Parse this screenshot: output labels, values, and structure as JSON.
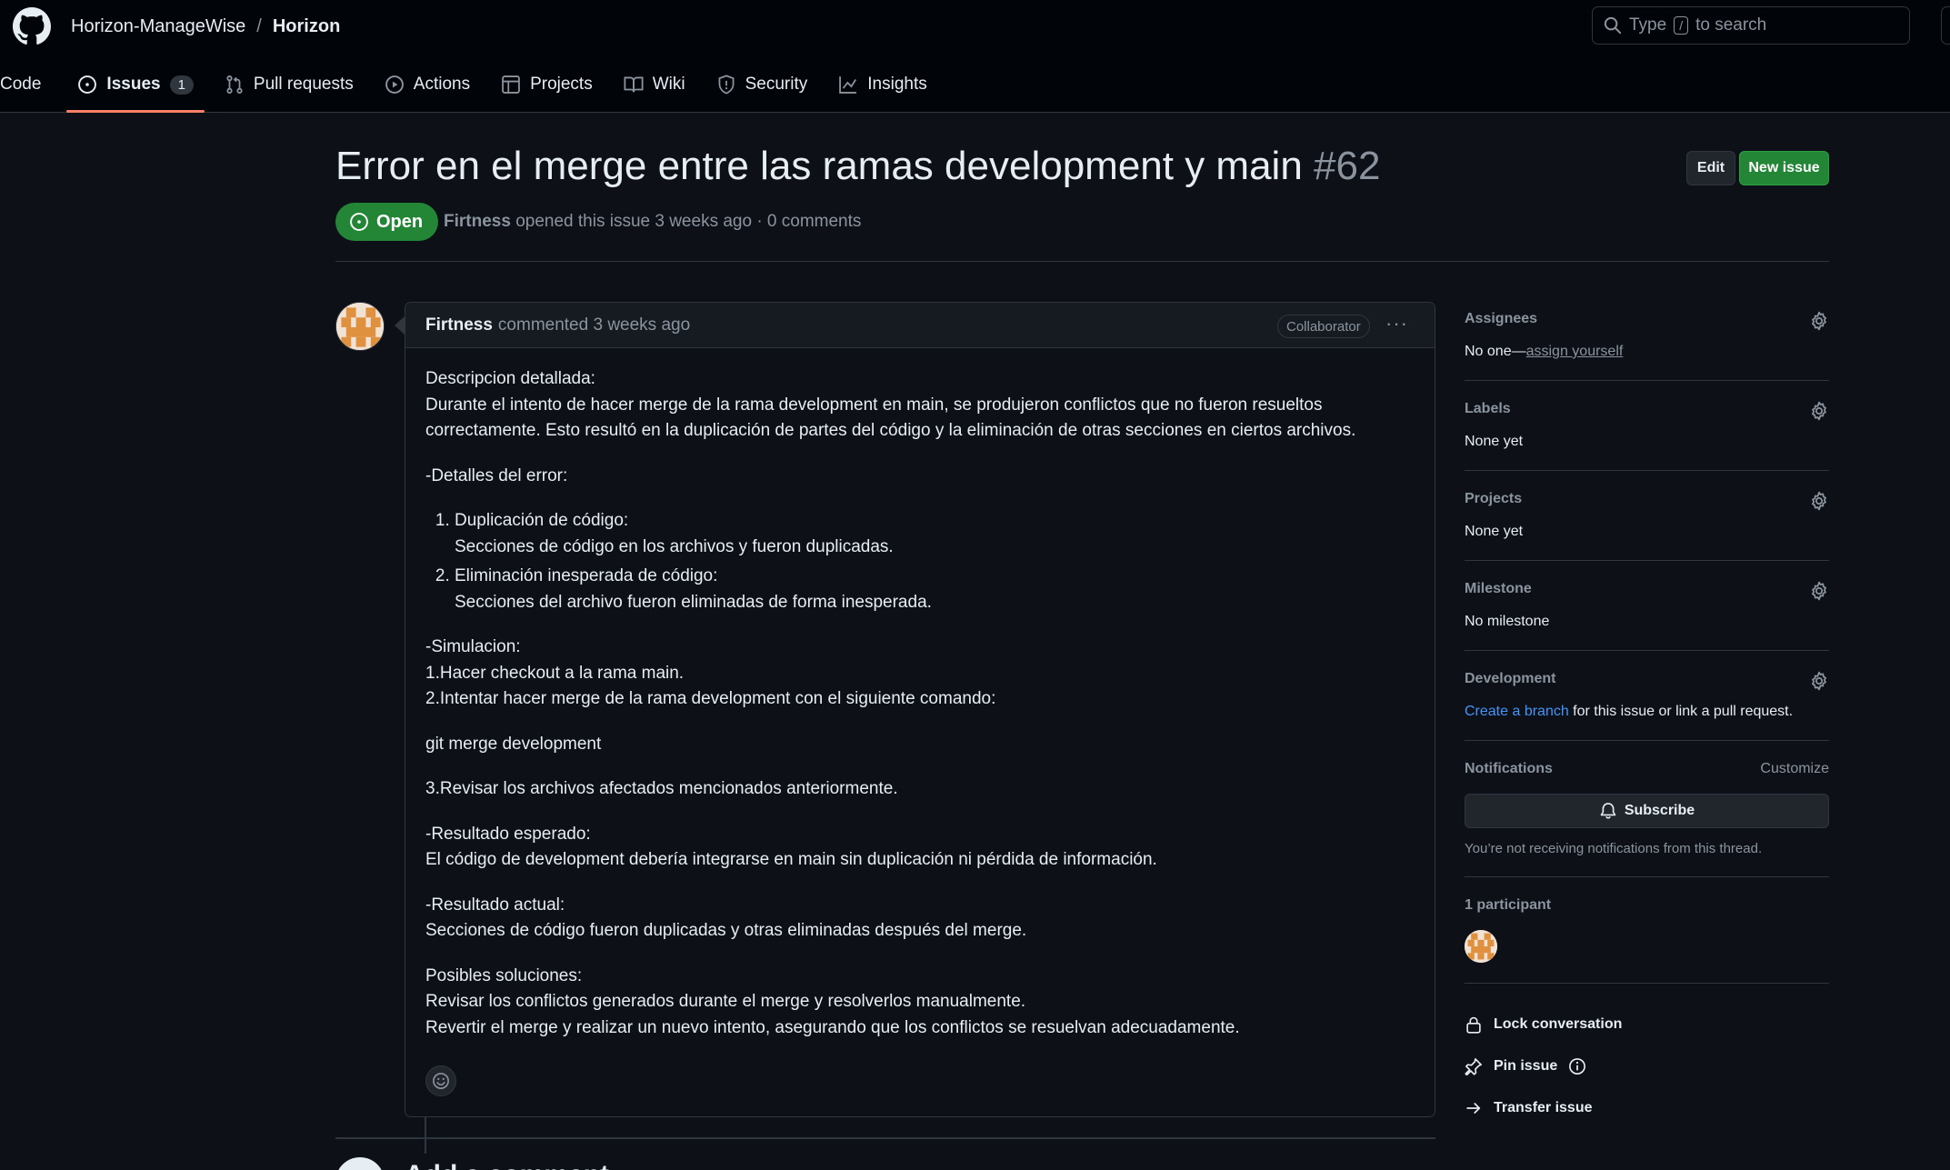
{
  "header": {
    "owner": "Horizon-ManageWise",
    "separator": "/",
    "repo": "Horizon",
    "search_prefix": "Type",
    "search_key": "/",
    "search_suffix": "to search"
  },
  "tabs": [
    {
      "label": "Code"
    },
    {
      "label": "Issues",
      "count": "1"
    },
    {
      "label": "Pull requests"
    },
    {
      "label": "Actions"
    },
    {
      "label": "Projects"
    },
    {
      "label": "Wiki"
    },
    {
      "label": "Security"
    },
    {
      "label": "Insights"
    }
  ],
  "issue": {
    "title": "Error en el merge entre las ramas development y main",
    "number": "#62",
    "state": "Open",
    "author": "Firtness",
    "meta_text": "opened this issue 3 weeks ago · 0 comments",
    "edit_label": "Edit",
    "new_label": "New issue"
  },
  "comment": {
    "author": "Firtness",
    "time_text": "commented 3 weeks ago",
    "role": "Collaborator",
    "more": "···",
    "p1": "Descripcion detallada:",
    "p2": "Durante el intento de hacer merge de la rama development en main, se produjeron conflictos que no fueron resueltos correctamente. Esto resultó en la duplicación de partes del código y la eliminación de otras secciones en ciertos archivos.",
    "details_heading": "-Detalles del error:",
    "item1_title": "Duplicación de código:",
    "item1_desc": "Secciones de código en los archivos y fueron duplicadas.",
    "item2_title": "Eliminación inesperada de código:",
    "item2_desc": "Secciones del archivo fueron eliminadas de forma inesperada.",
    "sim_heading": "-Simulacion:",
    "sim_step1": "1.Hacer checkout a la rama main.",
    "sim_step2": "2.Intentar hacer merge de la rama development con el siguiente comando:",
    "command": "git merge development",
    "sim_step3": "3.Revisar los archivos afectados mencionados anteriormente.",
    "expected_heading": "-Resultado esperado:",
    "expected_text": "El código de development debería integrarse en main sin duplicación ni pérdida de información.",
    "actual_heading": "-Resultado actual:",
    "actual_text": "Secciones de código fueron duplicadas y otras eliminadas después del merge.",
    "solutions_heading": "Posibles soluciones:",
    "solution1": "Revisar los conflictos generados durante el merge y resolverlos manualmente.",
    "solution2": "Revertir el merge y realizar un nuevo intento, asegurando que los conflictos se resuelvan adecuadamente."
  },
  "add_comment": "Add a comment",
  "sidebar": {
    "assignees": {
      "title": "Assignees",
      "value": "No one—",
      "link": "assign yourself"
    },
    "labels": {
      "title": "Labels",
      "value": "None yet"
    },
    "projects": {
      "title": "Projects",
      "value": "None yet"
    },
    "milestone": {
      "title": "Milestone",
      "value": "No milestone"
    },
    "development": {
      "title": "Development",
      "link": "Create a branch",
      "value": " for this issue or link a pull request."
    },
    "notifications": {
      "title": "Notifications",
      "customize": "Customize",
      "subscribe": "Subscribe",
      "note": "You’re not receiving notifications from this thread."
    },
    "participants": {
      "title": "1 participant"
    },
    "actions": {
      "lock": "Lock conversation",
      "pin": "Pin issue",
      "transfer": "Transfer issue"
    }
  },
  "colors": {
    "accent_green": "#238636",
    "tab_underline": "#f78166",
    "link_blue": "#4493f8",
    "avatar_orange": "#e0913f"
  }
}
